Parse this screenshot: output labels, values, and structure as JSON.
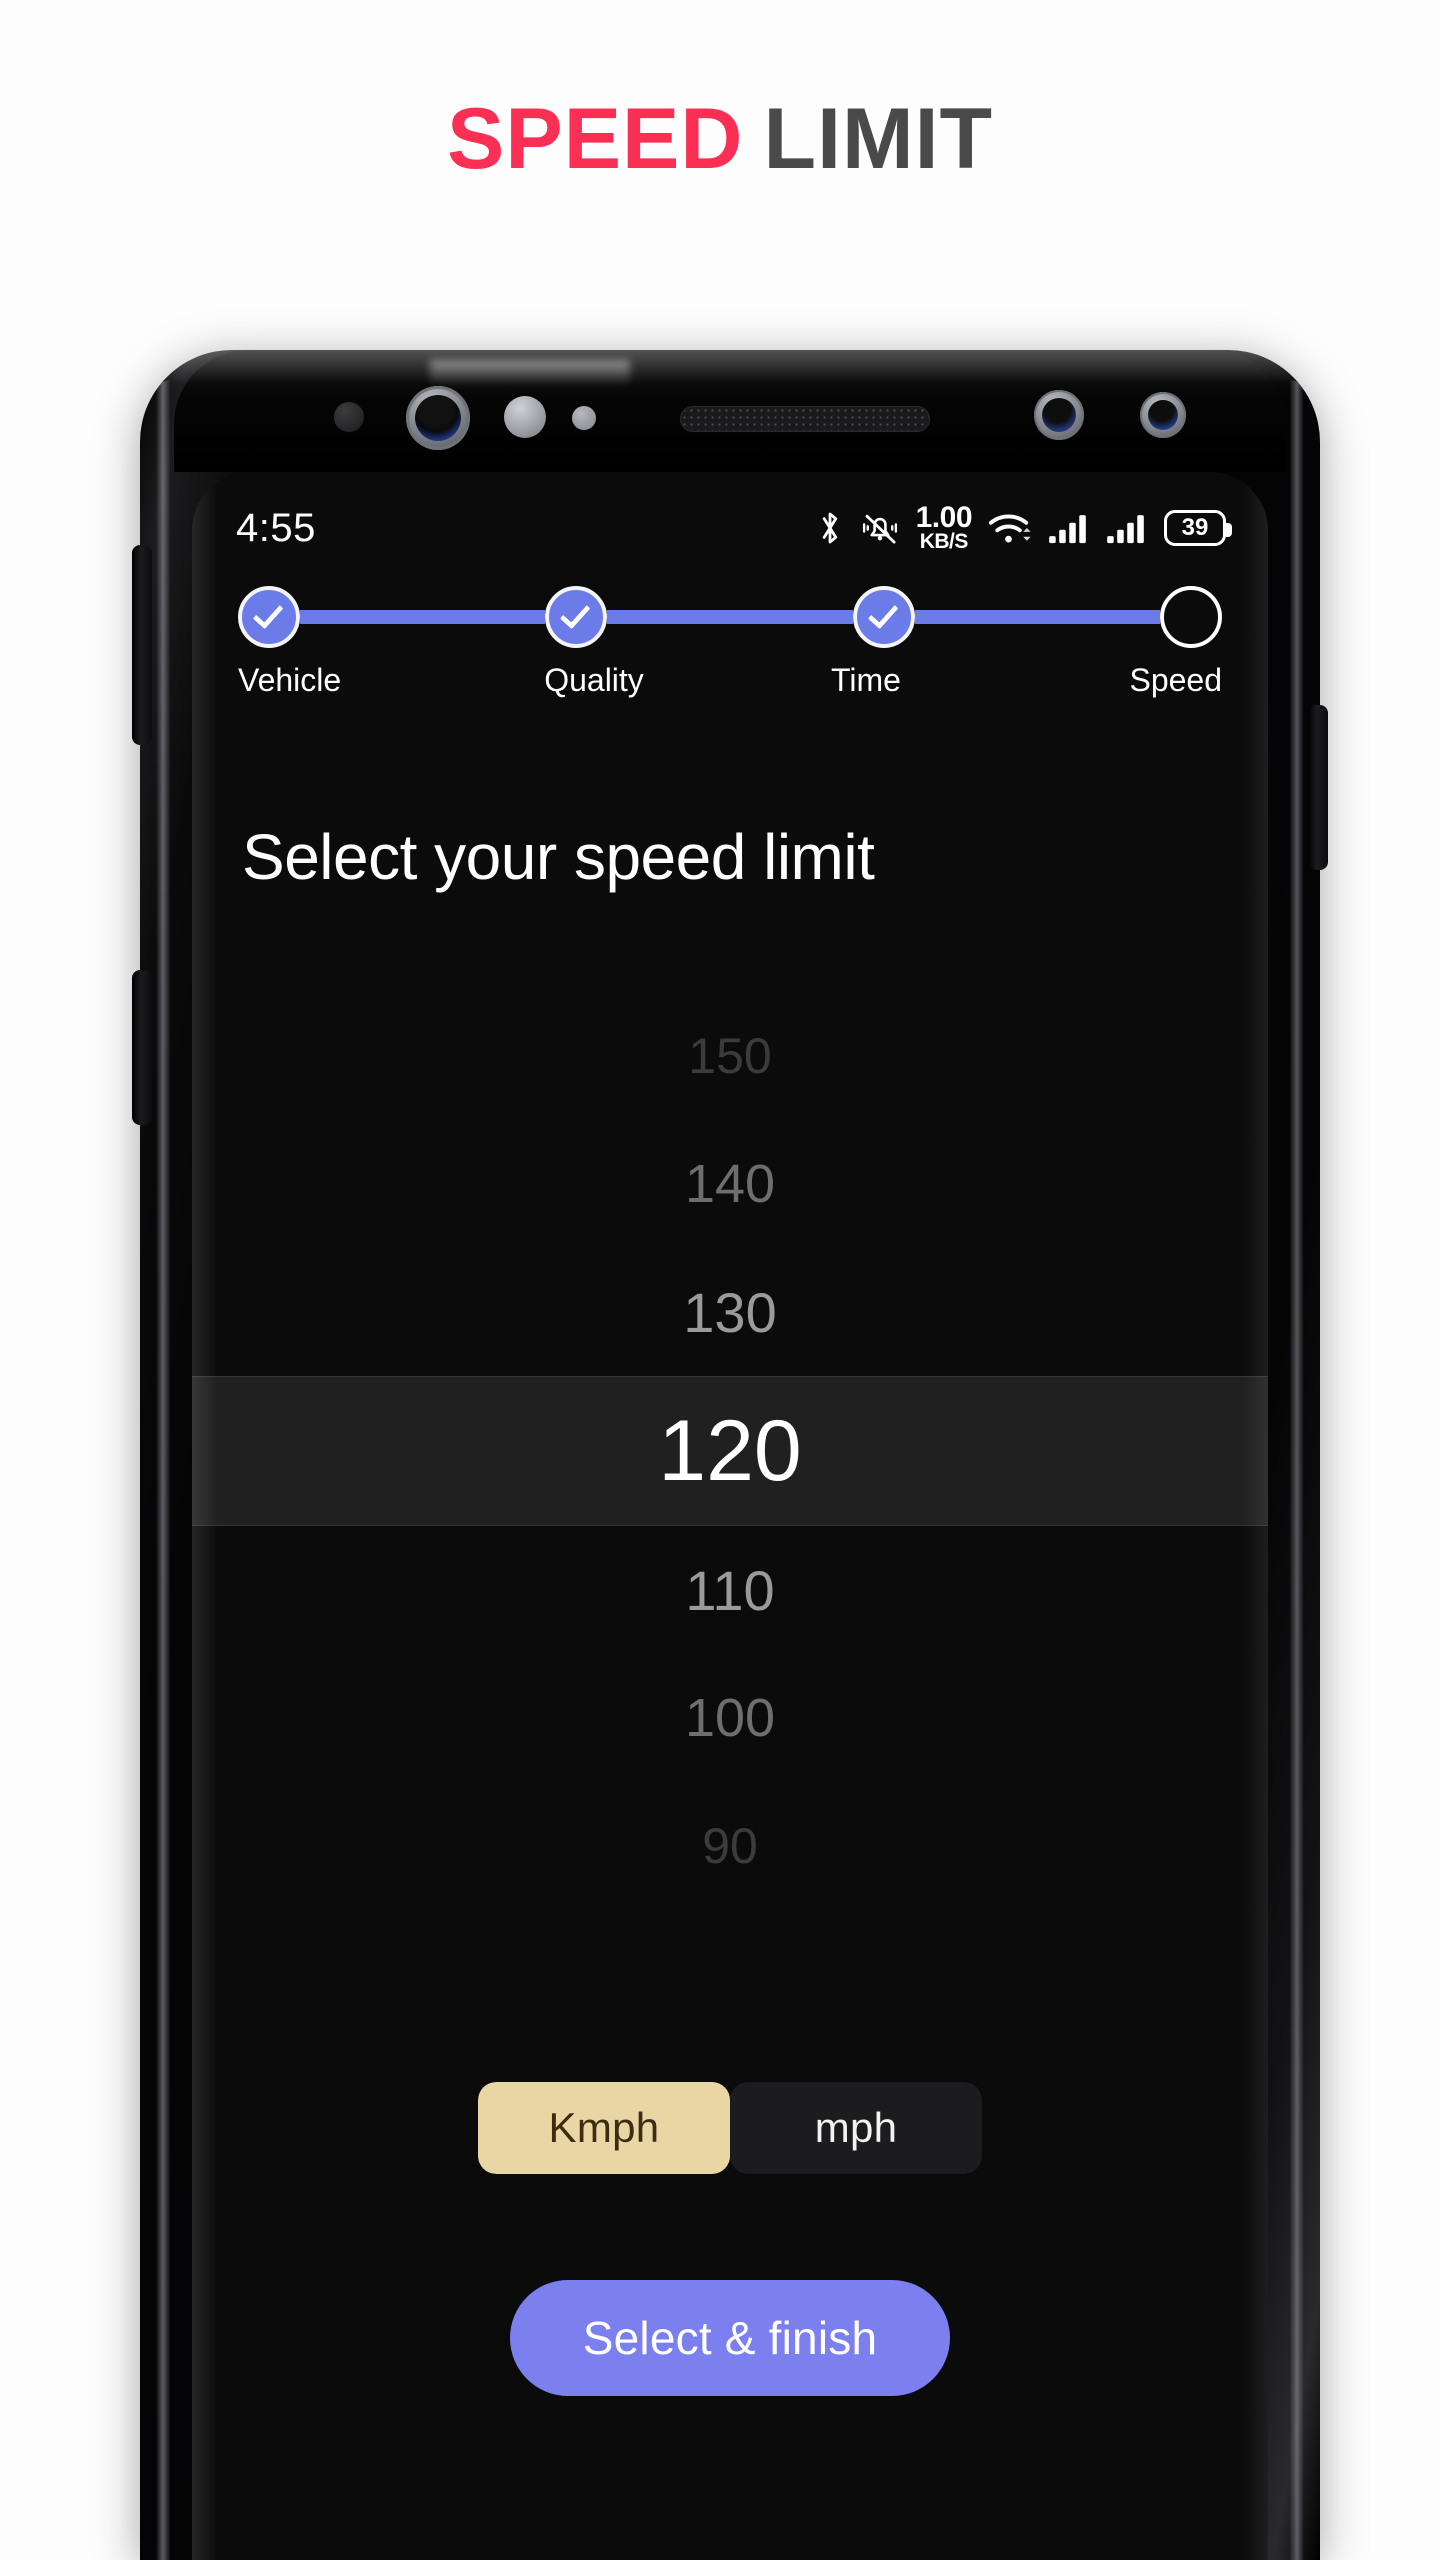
{
  "header": {
    "title_accent": "SPEED",
    "title_rest": "LIMIT",
    "accent_color": "#fb2f54",
    "rest_color": "#4a4a4a"
  },
  "status_bar": {
    "time": "4:55",
    "icons": [
      "bluetooth-icon",
      "vibrate-off-icon",
      "network-speed",
      "wifi-icon",
      "signal-sim1-icon",
      "signal-sim2-icon",
      "battery-icon"
    ],
    "network_speed_value": "1.00",
    "network_speed_unit": "KB/S",
    "battery_level": "39"
  },
  "stepper": {
    "steps": [
      {
        "label": "Vehicle",
        "state": "completed"
      },
      {
        "label": "Quality",
        "state": "completed"
      },
      {
        "label": "Time",
        "state": "completed"
      },
      {
        "label": "Speed",
        "state": "current"
      }
    ],
    "active_color": "#6b7ce8",
    "ring_color": "#f4f4f8"
  },
  "main": {
    "heading": "Select your speed limit",
    "picker": {
      "selected_value": "120",
      "rows": [
        {
          "value": "150",
          "style": "far"
        },
        {
          "value": "140",
          "style": "mid"
        },
        {
          "value": "130",
          "style": "near"
        },
        {
          "value": "120",
          "style": "selected"
        },
        {
          "value": "110",
          "style": "near"
        },
        {
          "value": "100",
          "style": "mid"
        },
        {
          "value": "90",
          "style": "far"
        }
      ]
    },
    "unit_toggle": {
      "options": [
        {
          "label": "Kmph",
          "selected": true
        },
        {
          "label": "mph",
          "selected": false
        }
      ],
      "active_bg": "#ead5a4",
      "active_fg": "#3c2d12"
    },
    "cta": {
      "label": "Select & finish",
      "bg": "#7b80ee",
      "fg": "#ffffff"
    }
  }
}
